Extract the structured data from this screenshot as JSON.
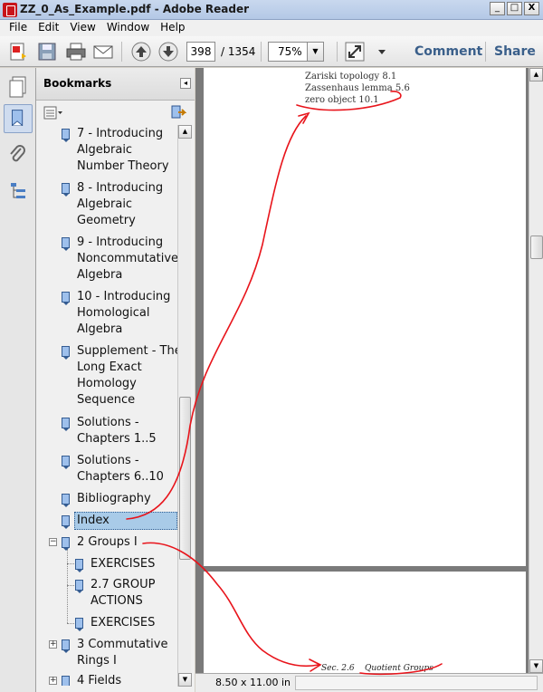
{
  "window": {
    "title": "ZZ_0_As_Example.pdf - Adobe Reader",
    "controls": [
      "_",
      "□",
      "X"
    ]
  },
  "menu": [
    "File",
    "Edit",
    "View",
    "Window",
    "Help"
  ],
  "toolbar": {
    "page_current": "398",
    "page_total": "/ 1354",
    "zoom": "75%",
    "comment_label": "Comment",
    "share_label": "Share"
  },
  "bookmarks": {
    "title": "Bookmarks",
    "items": [
      {
        "label": "7 - Introducing\nAlgebraic\nNumber Theory"
      },
      {
        "label": "8 - Introducing\nAlgebraic\nGeometry"
      },
      {
        "label": "9 - Introducing\nNoncommutative\nAlgebra"
      },
      {
        "label": "10 - Introducing\nHomological\nAlgebra"
      },
      {
        "label": "Supplement - The\nLong Exact\nHomology\nSequence"
      },
      {
        "label": "Solutions -\nChapters 1..5"
      },
      {
        "label": "Solutions -\nChapters 6..10"
      },
      {
        "label": "Bibliography"
      },
      {
        "label": "Index",
        "selected": true
      },
      {
        "label": "2 Groups I",
        "expanded": true
      },
      {
        "label": "EXERCISES"
      },
      {
        "label": "2.7 GROUP\nACTIONS"
      },
      {
        "label": "EXERCISES"
      },
      {
        "label": "3 Commutative\nRings I",
        "expandable": true
      },
      {
        "label": "4 Fields",
        "expandable": true
      }
    ]
  },
  "document": {
    "index_lines": [
      "Zariski topology 8.1",
      "Zassenhaus lemma 5.6",
      "zero object 10.1"
    ],
    "running_header": "Sec. 2.6    Quotient Groups"
  },
  "status": {
    "page_size": "8.50 x 11.00 in"
  },
  "colors": {
    "annotation": "#e8141b",
    "selection": "#a9cbe8",
    "doc_background": "#7a7a7a"
  }
}
